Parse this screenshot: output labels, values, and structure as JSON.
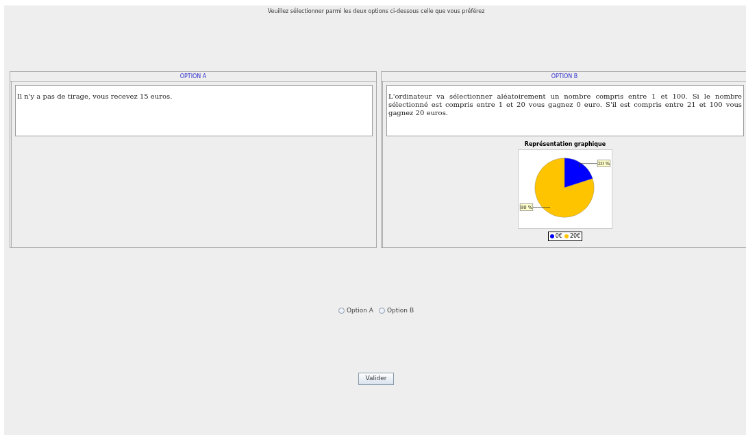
{
  "instruction": "Veuillez sélectionner parmi les deux options ci-dessous celle que vous préférez",
  "options": [
    {
      "title": "OPTION A",
      "description": "Il n'y a pas de tirage, vous recevez 15 euros."
    },
    {
      "title": "OPTION B",
      "description": "L'ordinateur va sélectionner aléatoirement un nombre compris entre 1 et 100. Si le nombre sélectionné est compris entre 1 et 20 vous gagnez 0 euro. S'il est compris entre 21 et 100 vous gagnez 20 euros.",
      "chart_data": {
        "type": "pie",
        "title": "Représentation graphique",
        "categories": [
          "0€",
          "20€"
        ],
        "values": [
          20,
          80
        ],
        "colors": [
          "#0000ff",
          "#ffc400"
        ],
        "value_labels": [
          "20 %",
          "80 %"
        ],
        "legend": "bottom"
      }
    }
  ],
  "choices": [
    {
      "label": "Option A",
      "selected": false
    },
    {
      "label": "Option B",
      "selected": false
    }
  ],
  "submit": "Valider"
}
